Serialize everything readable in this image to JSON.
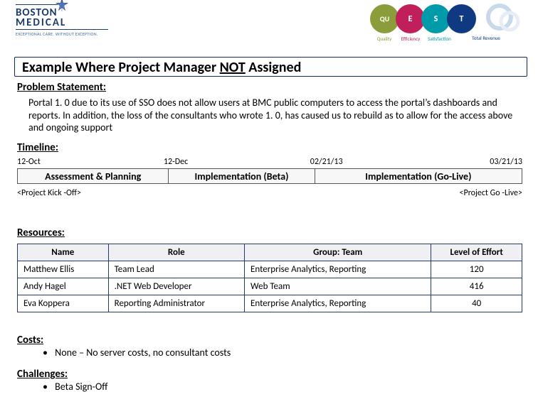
{
  "header": {
    "bmc_brand_top": "BOSTON",
    "bmc_brand_bottom": "MEDICAL",
    "bmc_tagline": "EXCEPTIONAL CARE. WITHOUT EXCEPTION.",
    "quest_circles": [
      "QU",
      "E",
      "S",
      "T"
    ],
    "quest_tags": [
      "Quality",
      "Efficiency",
      "Satisfaction",
      "Total Revenue"
    ]
  },
  "title_prefix": "Example Where Project Manager ",
  "title_not": "NOT",
  "title_suffix": " Assigned",
  "problem": {
    "label": "Problem Statement:",
    "body": "Portal 1. 0 due to its use of SSO does not allow users at BMC public computers to access the portal’s dashboards and reports. In addition, the loss of the consultants who wrote 1. 0, has caused us to rebuild as to allow for the access above and ongoing support"
  },
  "timeline": {
    "label": "Timeline:",
    "dates": [
      "12-Oct",
      "12-Dec",
      "02/21/13",
      "03/21/13"
    ],
    "phases": [
      "Assessment & Planning",
      "Implementation (Beta)",
      "Implementation (Go-Live)"
    ],
    "note_left": "<Project Kick   -Off>",
    "note_right": "<Project Go   -Live>"
  },
  "resources": {
    "label": "Resources:",
    "headers": [
      "Name",
      "Role",
      "Group: Team",
      "Level of Effort"
    ],
    "rows": [
      {
        "name": "Matthew Ellis",
        "role": "Team Lead",
        "group": "Enterprise Analytics, Reporting",
        "loe": "120"
      },
      {
        "name": "Andy Hagel",
        "role": ".NET Web Developer",
        "group": "Web Team",
        "loe": "416"
      },
      {
        "name": "Eva Koppera",
        "role": "Reporting Administrator",
        "group": "Enterprise Analytics, Reporting",
        "loe": "40"
      }
    ]
  },
  "costs": {
    "label": "Costs:",
    "item": "None – No server costs, no consultant costs"
  },
  "challenges": {
    "label": "Challenges:",
    "item": "Beta Sign-Off"
  }
}
